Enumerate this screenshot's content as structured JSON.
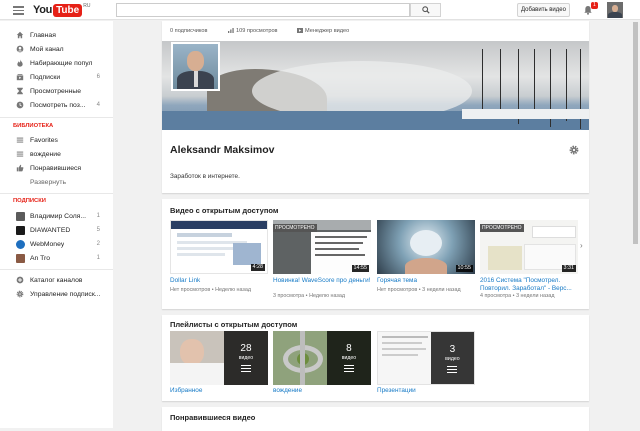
{
  "header": {
    "logo_you": "You",
    "logo_tube": "Tube",
    "logo_region": "RU",
    "search_placeholder": "",
    "upload_label": "Добавить видео",
    "notification_count": "1"
  },
  "sidebar": {
    "main": [
      {
        "label": "Главная",
        "icon": "home-icon"
      },
      {
        "label": "Мой канал",
        "icon": "person-icon"
      },
      {
        "label": "Набирающие популя...",
        "icon": "flame-icon"
      },
      {
        "label": "Подписки",
        "icon": "subscriptions-icon",
        "count": "6"
      },
      {
        "label": "Просмотренные",
        "icon": "history-icon"
      },
      {
        "label": "Посмотреть поз...",
        "icon": "watch-later-icon",
        "count": "4"
      }
    ],
    "library_title": "БИБЛИОТЕКА",
    "library": [
      {
        "label": "Favorites",
        "icon": "list-icon"
      },
      {
        "label": "вождение",
        "icon": "list-icon"
      },
      {
        "label": "Понравившиеся",
        "icon": "thumbs-up-icon"
      }
    ],
    "expand_label": "Развернуть",
    "subs_title": "ПОДПИСКИ",
    "subscriptions": [
      {
        "label": "Владимир Соля...",
        "count": "1",
        "color": "#5b5b5b"
      },
      {
        "label": "DIAWANTED",
        "count": "5",
        "color": "#1a1a1a"
      },
      {
        "label": "WebMoney",
        "count": "2",
        "color": "#1e6fbf"
      },
      {
        "label": "An Tro",
        "count": "1",
        "color": "#8a5a44"
      }
    ],
    "footer": [
      {
        "label": "Каталог каналов",
        "icon": "plus-circle-icon"
      },
      {
        "label": "Управление подписк...",
        "icon": "gear-icon"
      }
    ]
  },
  "channel": {
    "subscribers": "0 подписчиков",
    "views": "109 просмотров",
    "manager": "Менеджер видео",
    "name": "Aleksandr Maksimov",
    "description": "Заработок в интернете."
  },
  "public_videos": {
    "title": "Видео с открытым доступом",
    "items": [
      {
        "title": "Dollar Link",
        "views": "Нет просмотров",
        "age": "Неделю назад",
        "duration": "4:28",
        "thumb_label": ""
      },
      {
        "title": "Новинка! WaveScore про деньги!",
        "views": "3 просмотра",
        "age": "Неделю назад",
        "duration": "14:55",
        "thumb_label": "ПРОСМОТРЕНО"
      },
      {
        "title": "Горячая тема",
        "views": "Нет просмотров",
        "age": "3 недели назад",
        "duration": "10:55",
        "thumb_label": ""
      },
      {
        "title": "2016 Система \"Посмотрел. Повторил. Заработал\" - Верс...",
        "views": "4 просмотра",
        "age": "3 недели назад",
        "duration": "3:31",
        "thumb_label": "ПРОСМОТРЕНО"
      }
    ]
  },
  "playlists": {
    "title": "Плейлисты с открытым доступом",
    "items": [
      {
        "title": "Избранное",
        "count": "28",
        "unit": "видео"
      },
      {
        "title": "вождение",
        "count": "8",
        "unit": "видео"
      },
      {
        "title": "Презентации",
        "count": "3",
        "unit": "видео"
      }
    ]
  },
  "liked": {
    "title": "Понравившиеся видео"
  }
}
